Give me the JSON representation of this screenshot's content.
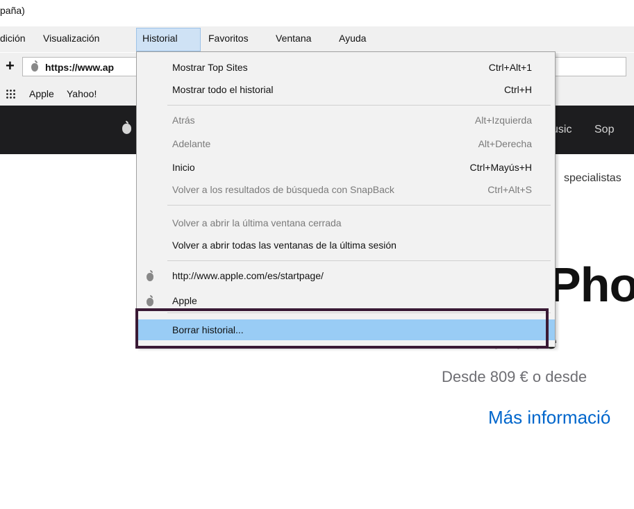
{
  "window": {
    "title_fragment": "paña)"
  },
  "menubar": {
    "items": [
      "dición",
      "Visualización",
      "Historial",
      "Favoritos",
      "Ventana",
      "Ayuda"
    ]
  },
  "urlbar": {
    "plus": "+",
    "url": "https://www.ap"
  },
  "bookmarks": {
    "items": [
      "Apple",
      "Yahoo!"
    ]
  },
  "apple_nav": {
    "items": [
      "usic",
      "Sop"
    ]
  },
  "page": {
    "ribbon": "specialistas",
    "hero_title": "Pho",
    "hero_sub": "allá de",
    "hero_price": "Desde 809 € o desde",
    "hero_link": "Más informació"
  },
  "history_menu": {
    "top_sites": {
      "label": "Mostrar Top Sites",
      "shortcut": "Ctrl+Alt+1"
    },
    "all_history": {
      "label": "Mostrar todo el historial",
      "shortcut": "Ctrl+H"
    },
    "back": {
      "label": "Atrás",
      "shortcut": "Alt+Izquierda"
    },
    "forward": {
      "label": "Adelante",
      "shortcut": "Alt+Derecha"
    },
    "home": {
      "label": "Inicio",
      "shortcut": "Ctrl+Mayús+H"
    },
    "snapback": {
      "label": "Volver a los resultados de búsqueda con SnapBack",
      "shortcut": "Ctrl+Alt+S"
    },
    "reopen_window": {
      "label": "Volver a abrir la última ventana cerrada"
    },
    "reopen_all": {
      "label": "Volver a abrir todas las ventanas de la última sesión"
    },
    "history_1": {
      "label": "http://www.apple.com/es/startpage/",
      "icon": "apple-icon"
    },
    "history_2": {
      "label": "Apple",
      "icon": "apple-icon"
    },
    "clear": {
      "label": "Borrar historial..."
    }
  },
  "colors": {
    "highlight": "#99ccf5",
    "focus_border": "#3a1a35",
    "link": "#0066cc"
  }
}
